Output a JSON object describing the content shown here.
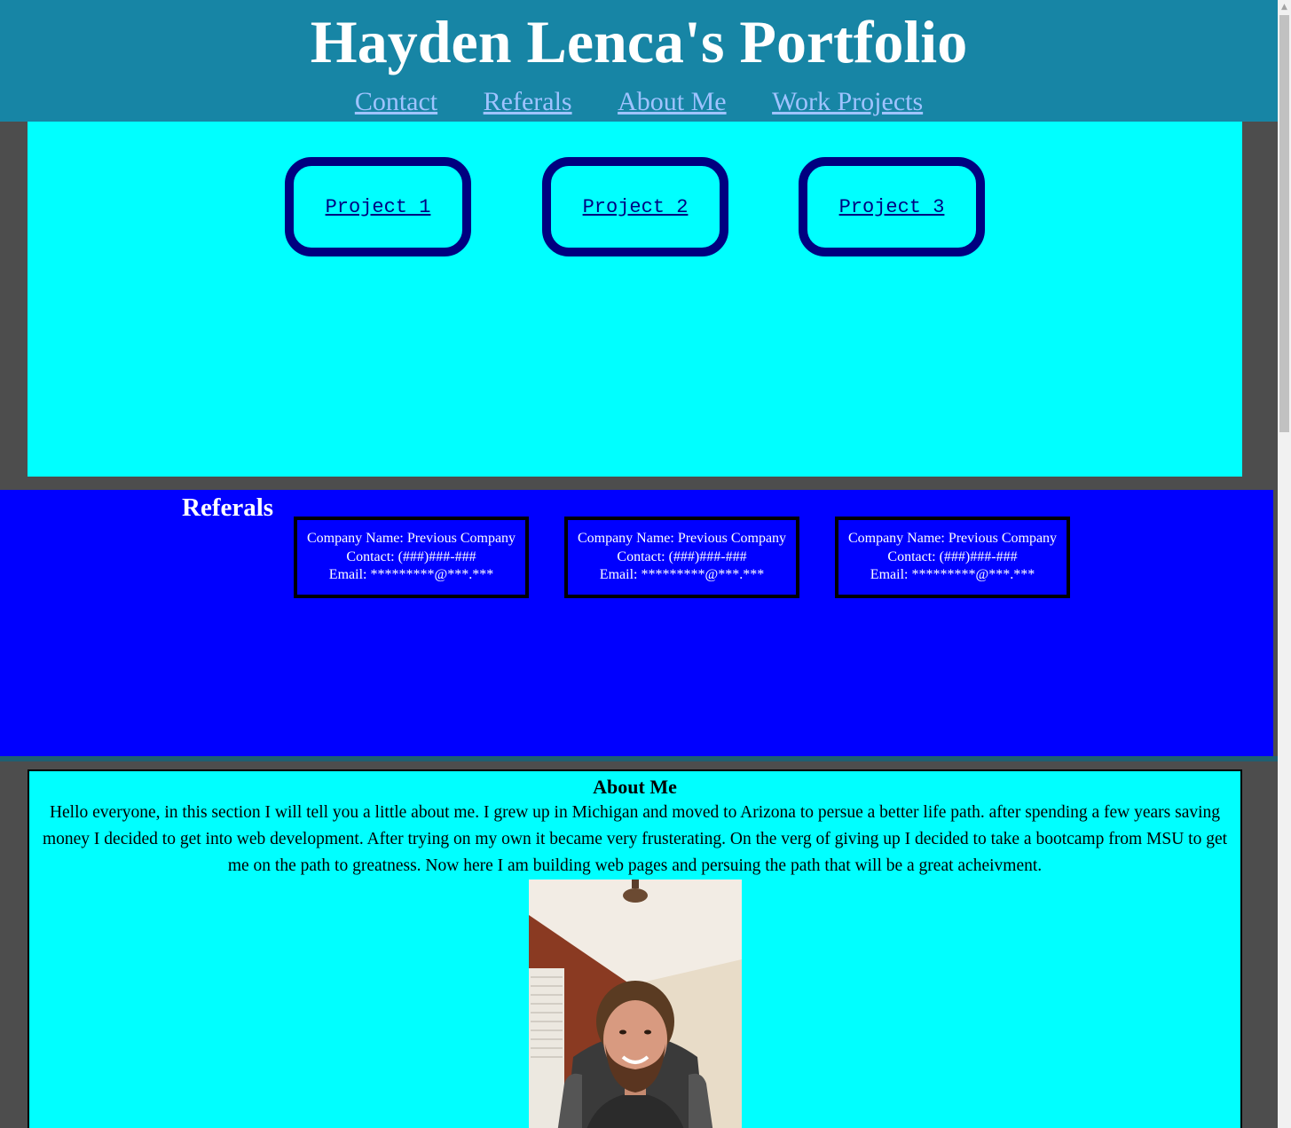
{
  "header": {
    "title": "Hayden Lenca's Portfolio",
    "nav": [
      "Contact",
      "Referals",
      "About Me",
      "Work Projects"
    ]
  },
  "work_projects": {
    "projects": [
      "Project 1",
      "Project 2",
      "Project 3"
    ]
  },
  "referals": {
    "title": "Referals",
    "cards": [
      {
        "company": "Company Name: Previous Company",
        "contact": "Contact: (###)###-###",
        "email": "Email: *********@***.***"
      },
      {
        "company": "Company Name: Previous Company",
        "contact": "Contact: (###)###-###",
        "email": "Email: *********@***.***"
      },
      {
        "company": "Company Name: Previous Company",
        "contact": "Contact: (###)###-###",
        "email": "Email: *********@***.***"
      }
    ]
  },
  "about": {
    "title": "About Me",
    "text": "Hello everyone, in this section I will tell you a little about me. I grew up in Michigan and moved to Arizona to persue a better life path. after spending a few years saving money I decided to get into web development. After trying on my own it became very frusterating. On the verg of giving up I decided to take a bootcamp from MSU to get me on the path to greatness. Now here I am building web pages and persuing the path that will be a great acheivment."
  },
  "colors": {
    "header_bg": "#1785a5",
    "nav_link": "#9fc3ff",
    "work_bg": "#00ffff",
    "project_border": "#000080",
    "referals_bg": "#0000ff",
    "about_bg": "#00ffff",
    "page_bg": "#4d4d4d"
  }
}
